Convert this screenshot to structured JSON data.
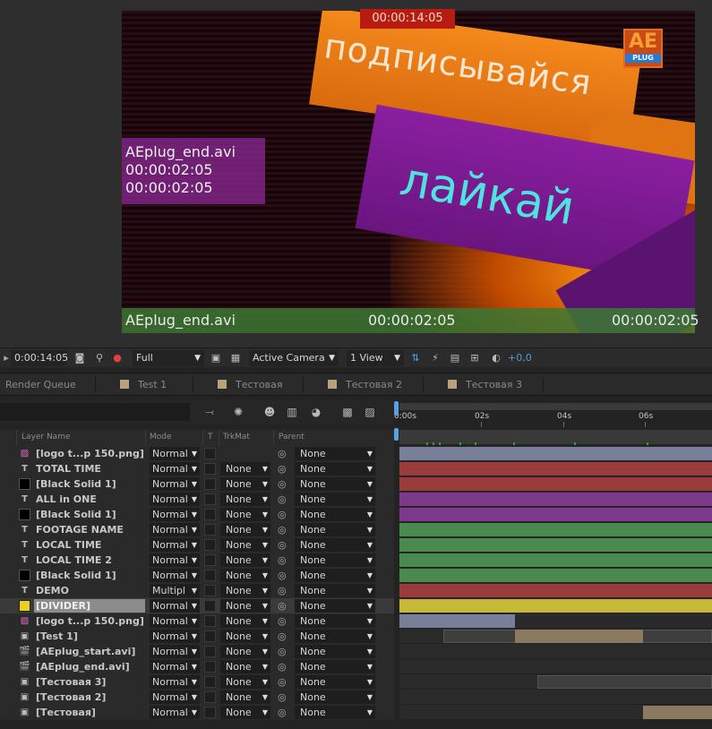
{
  "viewer": {
    "timecode_overlay": "00:00:14:05",
    "headline": "подписывайся",
    "subline": "лайкай",
    "logo_top": "AE",
    "logo_bottom": "PLUG",
    "info": {
      "file": "AEplug_end.avi",
      "line1": "00:00:02:05",
      "line2": "00:00:02:05"
    },
    "bottom": {
      "file": "AEplug_end.avi",
      "center": "00:00:02:05",
      "right": "00:00:02:05"
    }
  },
  "viewer_toolbar": {
    "current_time": "0:00:14:05",
    "resolution": "Full",
    "camera": "Active Camera",
    "view_layout": "1 View",
    "exposure": "+0,0"
  },
  "tabs": [
    {
      "label": "Render Queue",
      "swatch": false
    },
    {
      "label": "Test 1",
      "swatch": true
    },
    {
      "label": "Тестовая",
      "swatch": true
    },
    {
      "label": "Тестовая 2",
      "swatch": true
    },
    {
      "label": "Тестовая 3",
      "swatch": true
    }
  ],
  "columns": {
    "layer_name": "Layer Name",
    "mode": "Mode",
    "t": "T",
    "trkmat": "TrkMat",
    "parent": "Parent"
  },
  "ruler": {
    "labels": [
      "0:00s",
      "02s",
      "04s",
      "06s"
    ]
  },
  "layers": [
    {
      "icon": "image-icon",
      "name": "[logo t...p 150.png]",
      "mode": "Normal",
      "trkmat": "",
      "parent": "None",
      "bar_color": "#7a7f99",
      "bar_start": 0,
      "bar_end": 1
    },
    {
      "icon": "text-icon",
      "name": "TOTAL TIME",
      "mode": "Normal",
      "trkmat": "None",
      "parent": "None",
      "bar_color": "#9b3c3c",
      "bar_start": 0,
      "bar_end": 1
    },
    {
      "icon": "solid-icon",
      "name": "[Black Solid 1]",
      "mode": "Normal",
      "trkmat": "None",
      "parent": "None",
      "bar_color": "#9b3c3c",
      "bar_start": 0,
      "bar_end": 1
    },
    {
      "icon": "text-icon",
      "name": "ALL in ONE",
      "mode": "Normal",
      "trkmat": "None",
      "parent": "None",
      "bar_color": "#7d3a8c",
      "bar_start": 0,
      "bar_end": 1
    },
    {
      "icon": "solid-icon",
      "name": "[Black Solid 1]",
      "mode": "Normal",
      "trkmat": "None",
      "parent": "None",
      "bar_color": "#7d3a8c",
      "bar_start": 0,
      "bar_end": 1
    },
    {
      "icon": "text-icon",
      "name": "FOOTAGE NAME",
      "mode": "Normal",
      "trkmat": "None",
      "parent": "None",
      "bar_color": "#4a8a4e",
      "bar_start": 0,
      "bar_end": 1
    },
    {
      "icon": "text-icon",
      "name": "LOCAL TIME",
      "mode": "Normal",
      "trkmat": "None",
      "parent": "None",
      "bar_color": "#4a8a4e",
      "bar_start": 0,
      "bar_end": 1
    },
    {
      "icon": "text-icon",
      "name": "LOCAL TIME 2",
      "mode": "Normal",
      "trkmat": "None",
      "parent": "None",
      "bar_color": "#4a8a4e",
      "bar_start": 0,
      "bar_end": 1
    },
    {
      "icon": "solid-icon",
      "name": "[Black Solid 1]",
      "mode": "Normal",
      "trkmat": "None",
      "parent": "None",
      "bar_color": "#4a8a4e",
      "bar_start": 0,
      "bar_end": 1
    },
    {
      "icon": "text-icon",
      "name": "DEMO",
      "mode": "Multipl",
      "trkmat": "None",
      "parent": "None",
      "bar_color": "#9b3c3c",
      "bar_start": 0,
      "bar_end": 1
    },
    {
      "icon": "solid-yellow-icon",
      "name": "[DIVIDER]",
      "mode": "Normal",
      "trkmat": "None",
      "parent": "None",
      "bar_color": "#c8b83a",
      "bar_start": 0,
      "bar_end": 1,
      "selected": true
    },
    {
      "icon": "image-icon",
      "name": "[logo t...p 150.png]",
      "mode": "Normal",
      "trkmat": "None",
      "parent": "None",
      "bar_color": "#7a7f99",
      "bar_start": 0,
      "bar_end": 0.37
    },
    {
      "icon": "comp-icon",
      "name": "[Test 1]",
      "mode": "Normal",
      "trkmat": "None",
      "parent": "None",
      "bar_color": "#8a7a60",
      "bar_start": 0.37,
      "bar_end": 0.78,
      "ghost_start": 0.14,
      "ghost_end": 1
    },
    {
      "icon": "footage-icon",
      "name": "[AEplug_start.avi]",
      "mode": "Normal",
      "trkmat": "None",
      "parent": "None",
      "bar_color": "",
      "bar_start": 0,
      "bar_end": 0
    },
    {
      "icon": "footage-icon",
      "name": "[AEplug_end.avi]",
      "mode": "Normal",
      "trkmat": "None",
      "parent": "None",
      "bar_color": "",
      "bar_start": 0,
      "bar_end": 0
    },
    {
      "icon": "comp-icon",
      "name": "[Тестовая 3]",
      "mode": "Normal",
      "trkmat": "None",
      "parent": "None",
      "bar_color": "",
      "bar_start": 0,
      "bar_end": 0,
      "ghost_start": 0.44,
      "ghost_end": 1
    },
    {
      "icon": "comp-icon",
      "name": "[Тестовая 2]",
      "mode": "Normal",
      "trkmat": "None",
      "parent": "None",
      "bar_color": "",
      "bar_start": 0,
      "bar_end": 0
    },
    {
      "icon": "comp-icon",
      "name": "[Тестовая]",
      "mode": "Normal",
      "trkmat": "None",
      "parent": "None",
      "bar_color": "#8a7a60",
      "bar_start": 0.78,
      "bar_end": 1
    }
  ]
}
